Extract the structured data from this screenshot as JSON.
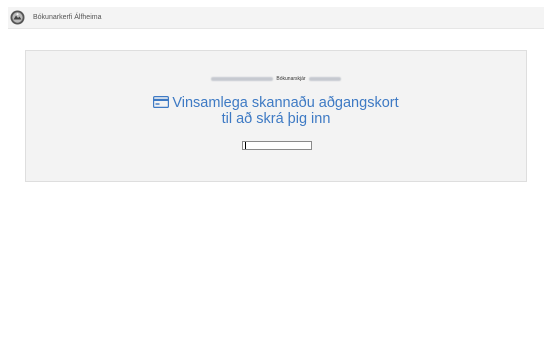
{
  "header": {
    "app_title": "Bókunarkerfi Álfheima",
    "logo_icon": "app-logo-icon"
  },
  "panel": {
    "breadcrumb_label": "Bókunarskjár",
    "headline_line1": "Vinsamlega skannaðu aðgangskort",
    "headline_line2": "til að skrá þig inn",
    "headline_icon": "credit-card-icon",
    "scan_input": {
      "value": "",
      "placeholder": ""
    }
  },
  "colors": {
    "accent": "#3e7ac4",
    "panel_bg": "#f3f3f3",
    "header_bg": "#f4f4f4"
  }
}
